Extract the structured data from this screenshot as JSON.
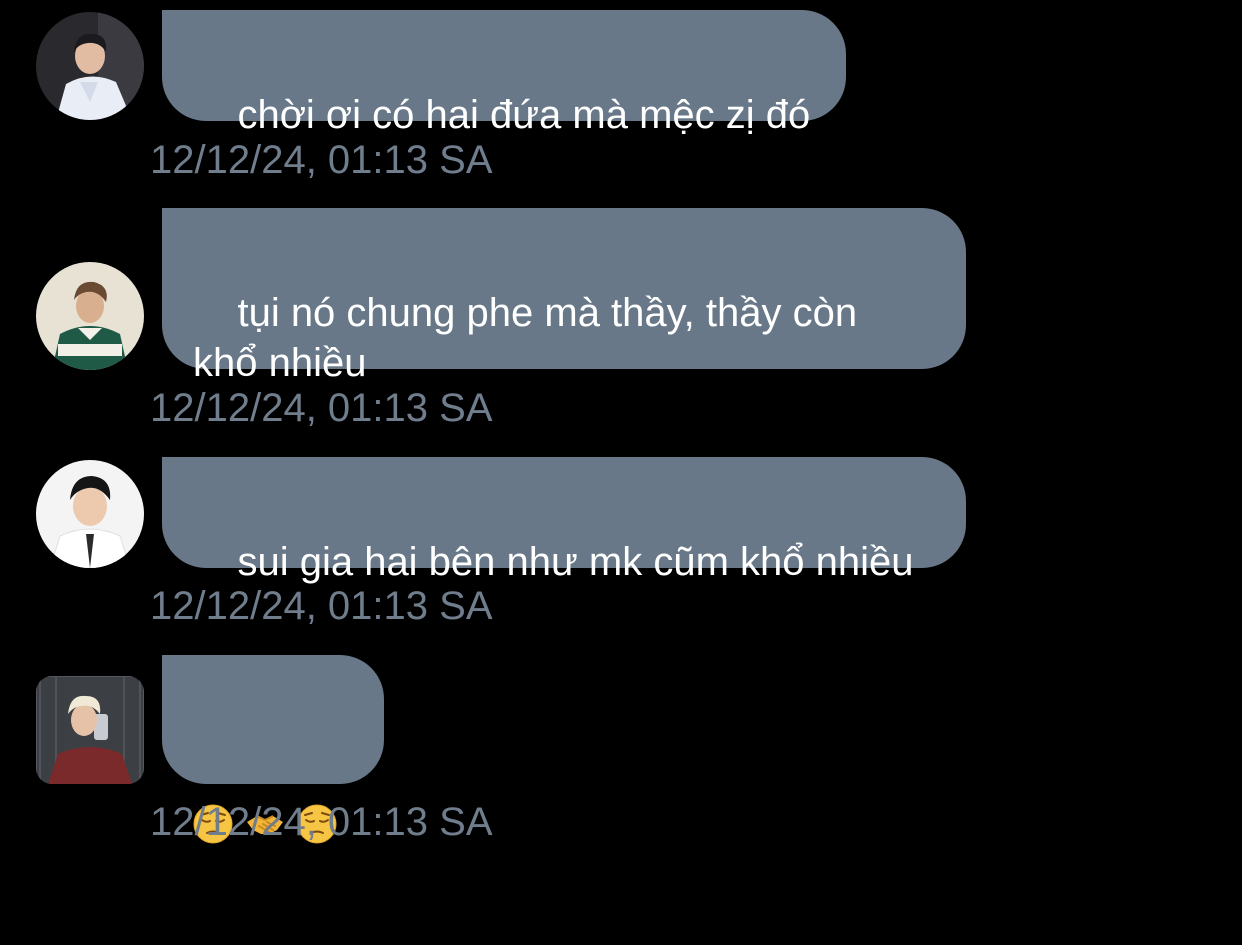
{
  "conversation": {
    "messages": [
      {
        "text": "chời ơi có hai đứa mà mệc zị đó",
        "timestamp": "12/12/24, 01:13 SA",
        "avatar": "avatar-man-white-shirt"
      },
      {
        "text": "tụi nó chung phe mà thầy, thầy còn\nkhổ nhiều",
        "timestamp": "12/12/24, 01:13 SA",
        "avatar": "avatar-man-striped-sweater"
      },
      {
        "text": "sui gia hai bên như mk cũm khổ nhiều",
        "timestamp": "12/12/24, 01:13 SA",
        "avatar": "avatar-man-white-shirt-tie"
      },
      {
        "emojis": [
          "pensive-face",
          "handshake",
          "pensive-face"
        ],
        "timestamp": "12/12/24, 01:13 SA",
        "avatar": "avatar-blond-man-mirror-selfie"
      }
    ]
  },
  "colors": {
    "background": "#000000",
    "bubble": "#687888",
    "bubble_text": "#ffffff",
    "timestamp": "#6f7d8c"
  }
}
